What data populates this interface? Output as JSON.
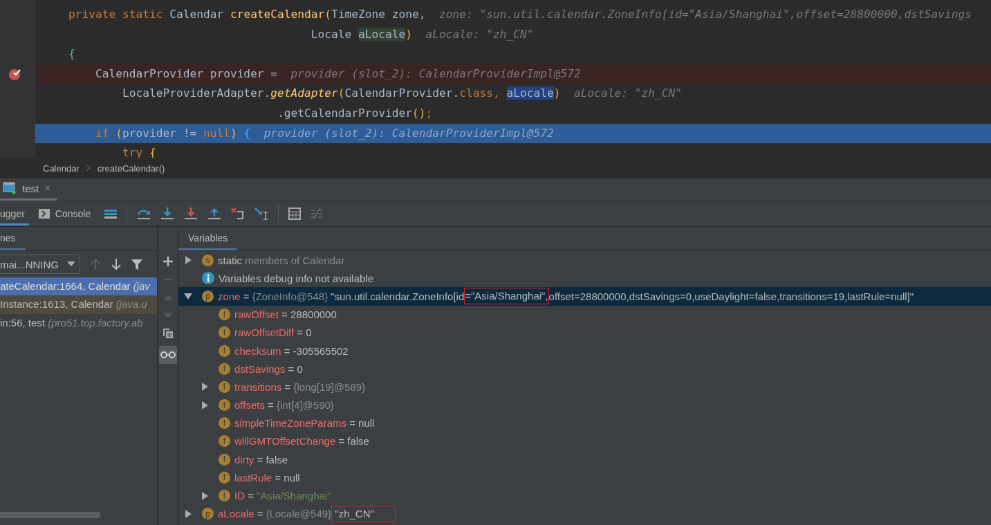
{
  "editor": {
    "lines": [
      {
        "kind": "normal",
        "tokens": [
          {
            "t": "    private static ",
            "kind": "kw"
          },
          {
            "t": "Calendar ",
            "kind": "plain"
          },
          {
            "t": "createCalendar",
            "kind": "fn"
          },
          {
            "t": "(",
            "kind": "paren"
          },
          {
            "t": "TimeZone zone,  ",
            "kind": "plain"
          },
          {
            "t": "zone: \"sun.util.calendar.ZoneInfo[id=\"Asia/Shanghai\",offset=28800000,dstSavings",
            "kind": "hint"
          }
        ]
      },
      {
        "kind": "normal",
        "tokens": [
          {
            "t": "                                        Locale ",
            "kind": "plain"
          },
          {
            "t": "aLocale",
            "kind": "usage"
          },
          {
            "t": ")  ",
            "kind": "paren"
          },
          {
            "t": "aLocale: \"zh_CN\"",
            "kind": "hint"
          }
        ]
      },
      {
        "kind": "normal",
        "tokens": [
          {
            "t": "    {",
            "kind": "brace"
          }
        ]
      },
      {
        "kind": "breakpoint",
        "tokens": [
          {
            "t": "        CalendarProvider provider =  ",
            "kind": "plain"
          },
          {
            "t": "provider (slot_2): CalendarProviderImpl@572",
            "kind": "hint"
          }
        ]
      },
      {
        "kind": "normal",
        "tokens": [
          {
            "t": "            LocaleProviderAdapter.",
            "kind": "plain"
          },
          {
            "t": "getAdapter",
            "kind": "fni"
          },
          {
            "t": "(",
            "kind": "paren"
          },
          {
            "t": "CalendarProvider.",
            "kind": "plain"
          },
          {
            "t": "class",
            "kind": "kw"
          },
          {
            "t": ", ",
            "kind": "kw"
          },
          {
            "t": "aLocale",
            "kind": "selection"
          },
          {
            "t": ")  ",
            "kind": "paren"
          },
          {
            "t": "aLocale: \"zh_CN\"",
            "kind": "hint"
          }
        ]
      },
      {
        "kind": "normal",
        "tokens": [
          {
            "t": "                                   .getCalendarProvider",
            "kind": "plain"
          },
          {
            "t": "()",
            "kind": "paren"
          },
          {
            "t": ";",
            "kind": "kw"
          }
        ]
      },
      {
        "kind": "execution",
        "tokens": [
          {
            "t": "        if ",
            "kind": "kw"
          },
          {
            "t": "(",
            "kind": "paren"
          },
          {
            "t": "provider != ",
            "kind": "plain"
          },
          {
            "t": "null",
            "kind": "kw"
          },
          {
            "t": ") ",
            "kind": "paren"
          },
          {
            "t": "{  ",
            "kind": "bluebrace"
          },
          {
            "t": "provider (slot_2): CalendarProviderImpl@572",
            "kind": "hint"
          }
        ]
      },
      {
        "kind": "normal",
        "tokens": [
          {
            "t": "            try ",
            "kind": "kw"
          },
          {
            "t": "{",
            "kind": "paren"
          }
        ]
      }
    ]
  },
  "breadcrumbs": [
    "Calendar",
    "createCalendar()"
  ],
  "run_tab": {
    "label": "test",
    "close": "×"
  },
  "debug_tabs": [
    {
      "label": "ugger",
      "selected": true
    },
    {
      "label": "Console",
      "selected": false
    }
  ],
  "frames": {
    "header": "nes",
    "thread": "mai...NNING",
    "items": [
      {
        "name": "ateCalendar:1664, Calendar ",
        "location": "(jav",
        "selected": true,
        "library": false
      },
      {
        "name": "Instance:1613, Calendar ",
        "location": "(java.u",
        "selected": false,
        "library": true
      },
      {
        "name": "in:56, test ",
        "location": "(pro51.top.factory.ab",
        "selected": false,
        "library": false
      }
    ]
  },
  "variables": {
    "header": "Variables",
    "items": [
      {
        "badge": "s",
        "name": "static",
        "parts": [
          {
            "t": " members of Calendar",
            "kind": "ref"
          }
        ],
        "expanded": false,
        "selected": false
      },
      {
        "kind": "info",
        "name": "Variables debug info not available",
        "selected": false
      },
      {
        "badge": "p",
        "name": "zone",
        "parts": [
          {
            "t": " = ",
            "kind": "text"
          },
          {
            "t": "{ZoneInfo@548}",
            "kind": "ref"
          },
          {
            "t": " \"sun.util.calendar.ZoneInfo[id",
            "kind": "text"
          },
          {
            "t": "=\"Asia/Shanghai\",",
            "kind": "text",
            "boxed": true
          },
          {
            "t": "offset=28800000,dstSavings=0,useDaylight=false,transitions=19,lastRule=null]\"",
            "kind": "text"
          }
        ],
        "expanded": true,
        "selected": true,
        "children": [
          {
            "badge": "f",
            "name": "rawOffset",
            "parts": [
              {
                "t": " = 28800000",
                "kind": "text"
              }
            ],
            "selected": false
          },
          {
            "badge": "f",
            "name": "rawOffsetDiff",
            "parts": [
              {
                "t": " = 0",
                "kind": "text"
              }
            ],
            "selected": false
          },
          {
            "badge": "f",
            "name": "checksum",
            "parts": [
              {
                "t": " = -305565502",
                "kind": "text"
              }
            ],
            "selected": false
          },
          {
            "badge": "f",
            "name": "dstSavings",
            "parts": [
              {
                "t": " = 0",
                "kind": "text"
              }
            ],
            "selected": false
          },
          {
            "badge": "f",
            "name": "transitions",
            "parts": [
              {
                "t": " = ",
                "kind": "text"
              },
              {
                "t": "{long[19]@589}",
                "kind": "ref"
              }
            ],
            "expanded": false,
            "selected": false
          },
          {
            "badge": "f",
            "name": "offsets",
            "parts": [
              {
                "t": " = ",
                "kind": "text"
              },
              {
                "t": "{int[4]@590}",
                "kind": "ref"
              }
            ],
            "expanded": false,
            "selected": false
          },
          {
            "badge": "f",
            "name": "simpleTimeZoneParams",
            "parts": [
              {
                "t": " = null",
                "kind": "text"
              }
            ],
            "selected": false
          },
          {
            "badge": "f",
            "name": "willGMTOffsetChange",
            "parts": [
              {
                "t": " = false",
                "kind": "text"
              }
            ],
            "selected": false
          },
          {
            "badge": "f",
            "name": "dirty",
            "parts": [
              {
                "t": " = false",
                "kind": "text"
              }
            ],
            "selected": false
          },
          {
            "badge": "f",
            "name": "lastRule",
            "parts": [
              {
                "t": " = null",
                "kind": "text"
              }
            ],
            "selected": false
          },
          {
            "badge": "f",
            "name": "ID",
            "parts": [
              {
                "t": " = ",
                "kind": "text"
              },
              {
                "t": "\"Asia/Shanghai\"",
                "kind": "string"
              }
            ],
            "expanded": false,
            "selected": false
          }
        ]
      },
      {
        "badge": "p",
        "name": "aLocale",
        "parts": [
          {
            "t": " = ",
            "kind": "text"
          },
          {
            "t": "{Locale@549}",
            "kind": "ref"
          },
          {
            "t": " \"zh_CN\"",
            "kind": "text",
            "boxed": true
          }
        ],
        "expanded": false,
        "selected": false
      }
    ]
  }
}
